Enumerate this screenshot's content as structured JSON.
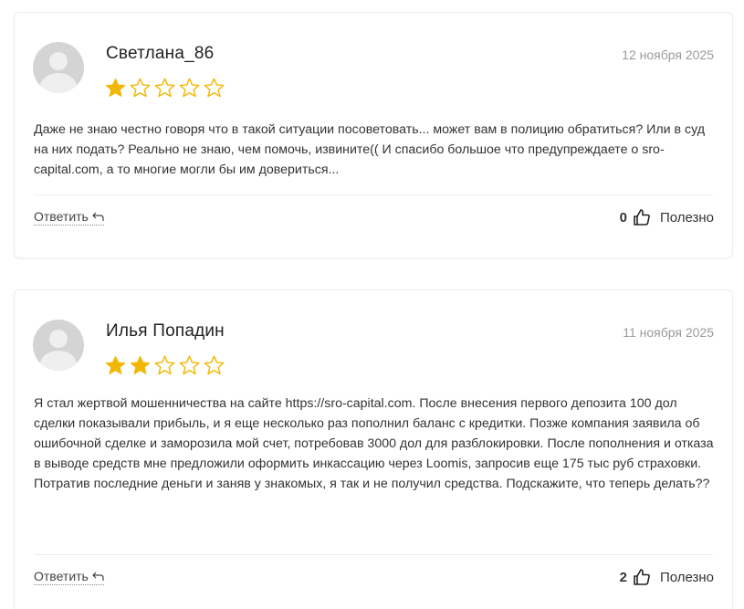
{
  "reviews": [
    {
      "author": "Светлана_86",
      "date": "12 ноября 2025",
      "rating": 1,
      "rating_max": 5,
      "text": "Даже не знаю честно говоря что в такой ситуации посоветовать... может вам в полицию обратиться? Или в суд на них подать? Реально не знаю, чем помочь, извините(( И спасибо большое что предупреждаете о sro-capital.com, а то многие могли бы им довериться...",
      "reply_label": "Ответить",
      "useful_count": "0",
      "useful_label": "Полезно"
    },
    {
      "author": "Илья Попадин",
      "date": "11 ноября 2025",
      "rating": 2,
      "rating_max": 5,
      "text": "Я стал жертвой мошенничества на сайте https://sro-capital.com. После внесения первого депозита 100 дол сделки показывали прибыль, и я еще несколько раз пополнил баланс с кредитки. Позже компания заявила об ошибочной сделке и заморозила мой счет, потребовав 3000 дол для разблокировки. После пополнения и отказа в выводе средств мне предложили оформить инкассацию через Loomis, запросив еще 175 тыс руб страховки. Потратив последние деньги и заняв у знакомых, я так и не получил средства. Подскажите, что теперь делать??",
      "reply_label": "Ответить",
      "useful_count": "2",
      "useful_label": "Полезно"
    }
  ],
  "colors": {
    "star_filled": "#f2b705",
    "star_empty": "#f2b705",
    "date": "#9a9a9a",
    "text": "#333333"
  },
  "icons": {
    "avatar": "default-user-avatar-icon",
    "reply": "reply-arrow-icon",
    "useful": "thumbs-up-icon",
    "star_filled": "star-filled-icon",
    "star_empty": "star-outline-icon"
  }
}
